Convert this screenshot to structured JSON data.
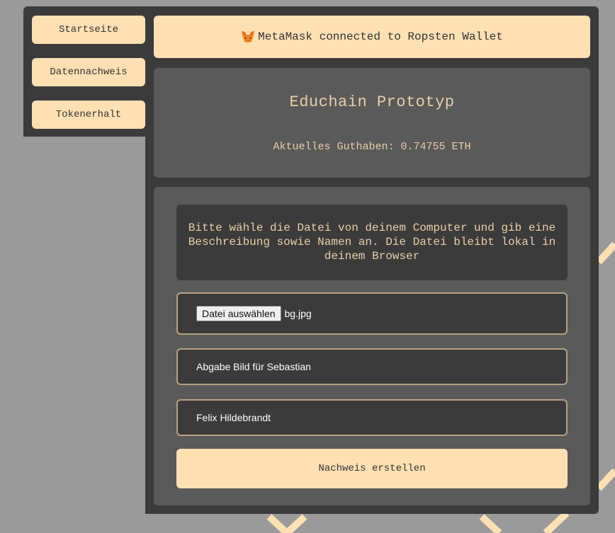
{
  "nav": {
    "items": [
      {
        "label": "Startseite"
      },
      {
        "label": "Datennachweis"
      },
      {
        "label": "Tokenerhalt"
      }
    ]
  },
  "header": {
    "status": "MetaMask connected to Ropsten Wallet",
    "icon": "metamask-fox-icon"
  },
  "hero": {
    "title": "Educhain Prototyp",
    "balance": "Aktuelles Guthaben: 0.74755 ETH"
  },
  "form": {
    "instructions": "Bitte wähle die Datei von deinem Computer und gib eine Beschreibung sowie Namen an. Die Datei bleibt lokal in deinem Browser",
    "file_button_label": "Datei auswählen",
    "file_name": "bg.jpg",
    "description_value": "Abgabe Bild für Sebastian",
    "name_value": "Felix Hildebrandt",
    "submit_label": "Nachweis erstellen"
  },
  "colors": {
    "background": "#9a9a9a",
    "panel_dark": "#3c3b3b",
    "panel_mid": "#5b5a5a",
    "accent": "#ffe0b3",
    "text_accent": "#e7cfa8",
    "border": "#b8a080"
  }
}
